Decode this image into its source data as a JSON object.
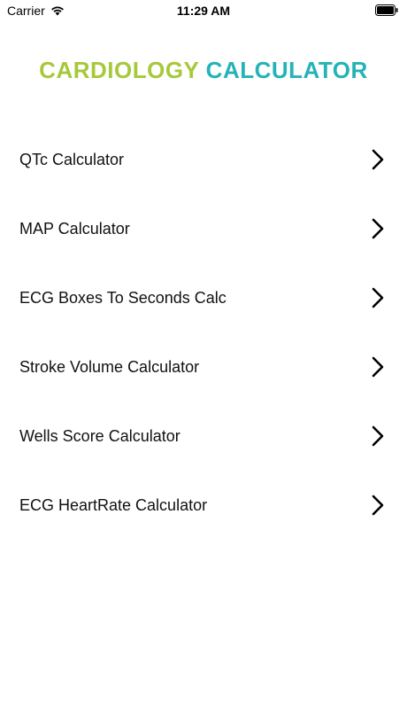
{
  "status_bar": {
    "carrier": "Carrier",
    "time": "11:29 AM"
  },
  "header": {
    "title_part1": "CARDIOLOGY",
    "title_part2": "CALCULATOR",
    "colors": {
      "part1": "#a6c93b",
      "part2": "#24b3b6"
    }
  },
  "menu": {
    "items": [
      {
        "label": "QTc Calculator",
        "icon": "chevron-right-icon"
      },
      {
        "label": "MAP Calculator",
        "icon": "chevron-right-icon"
      },
      {
        "label": "ECG Boxes To Seconds Calc",
        "icon": "chevron-right-icon"
      },
      {
        "label": "Stroke Volume Calculator",
        "icon": "chevron-right-icon"
      },
      {
        "label": "Wells Score Calculator",
        "icon": "chevron-right-icon"
      },
      {
        "label": "ECG HeartRate Calculator",
        "icon": "chevron-right-icon"
      }
    ]
  }
}
